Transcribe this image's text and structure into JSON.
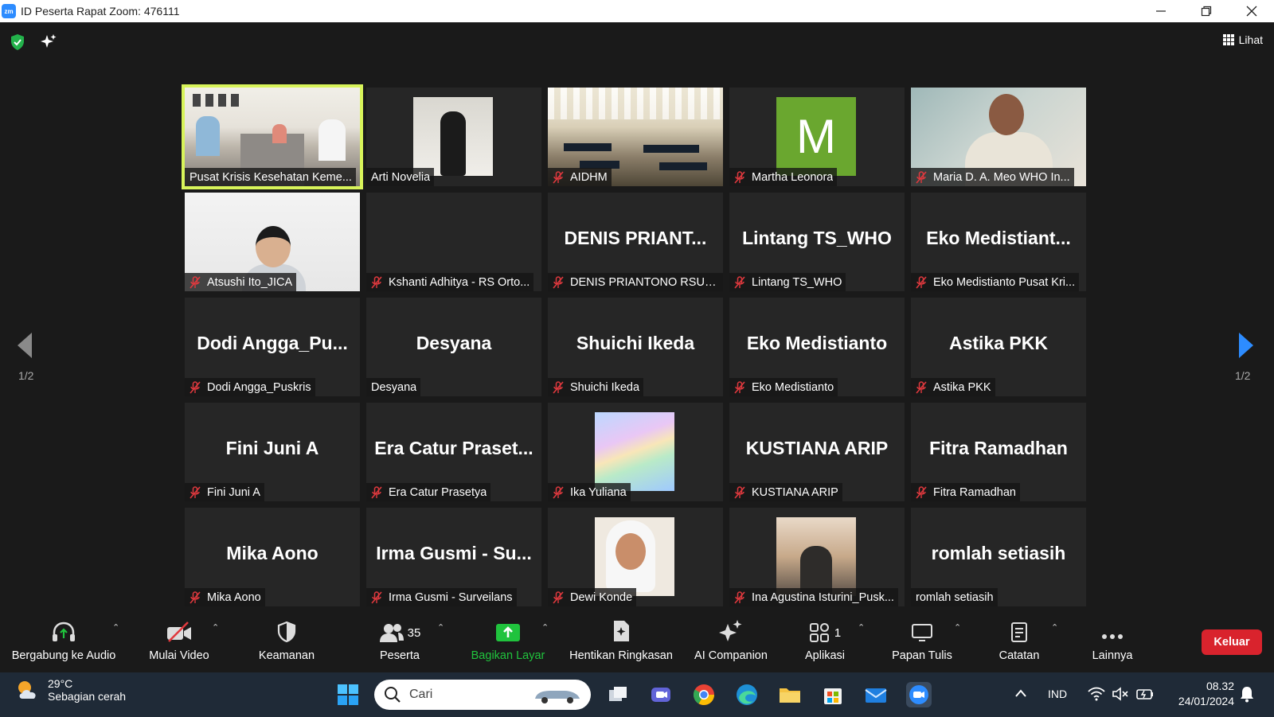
{
  "window": {
    "title": "ID Peserta Rapat Zoom: 476111",
    "app_logo": "zm",
    "controls": [
      "minimize-icon",
      "restore-icon",
      "close-icon"
    ]
  },
  "top": {
    "view_label": "Lihat"
  },
  "pagination": {
    "left": "1/2",
    "right": "1/2"
  },
  "participants": [
    {
      "label": "Pusat Krisis Kesehatan Keme...",
      "big_name": "",
      "muted": false,
      "photo": "room1",
      "active": true
    },
    {
      "label": "Arti Novelia",
      "big_name": "",
      "muted": false,
      "photo": "arti"
    },
    {
      "label": "AIDHM",
      "big_name": "",
      "muted": true,
      "photo": "hall"
    },
    {
      "label": "Martha Leonora",
      "big_name": "",
      "muted": true,
      "photo": "avatar",
      "avatar_letter": "M",
      "avatar_color": "#6aa72f"
    },
    {
      "label": "Maria D. A. Meo WHO In...",
      "big_name": "",
      "muted": true,
      "photo": "maria"
    },
    {
      "label": "Atsushi Ito_JICA",
      "big_name": "",
      "muted": true,
      "photo": "atsushi"
    },
    {
      "label": "Kshanti Adhitya - RS Orto...",
      "big_name": "",
      "muted": true,
      "photo": "none"
    },
    {
      "label": "DENIS PRIANTONO RSUP...",
      "big_name": "DENIS  PRIANT...",
      "muted": true,
      "photo": "none"
    },
    {
      "label": "Lintang TS_WHO",
      "big_name": "Lintang TS_WHO",
      "muted": true,
      "photo": "none"
    },
    {
      "label": "Eko Medistianto Pusat Kri...",
      "big_name": "Eko  Medistiant...",
      "muted": true,
      "photo": "none"
    },
    {
      "label": "Dodi Angga_Puskris",
      "big_name": "Dodi  Angga_Pu...",
      "muted": true,
      "photo": "none"
    },
    {
      "label": "Desyana",
      "big_name": "Desyana",
      "muted": false,
      "photo": "none"
    },
    {
      "label": "Shuichi Ikeda",
      "big_name": "Shuichi Ikeda",
      "muted": true,
      "photo": "none"
    },
    {
      "label": "Eko Medistianto",
      "big_name": "Eko Medistianto",
      "muted": true,
      "photo": "none"
    },
    {
      "label": "Astika PKK",
      "big_name": "Astika PKK",
      "muted": true,
      "photo": "none"
    },
    {
      "label": "Fini Juni A",
      "big_name": "Fini Juni A",
      "muted": true,
      "photo": "none"
    },
    {
      "label": "Era Catur Prasetya",
      "big_name": "Era  Catur  Praset...",
      "muted": true,
      "photo": "none"
    },
    {
      "label": "Ika Yuliana",
      "big_name": "",
      "muted": true,
      "photo": "rainbow"
    },
    {
      "label": "KUSTIANA ARIP",
      "big_name": "KUSTIANA ARIP",
      "muted": true,
      "photo": "none"
    },
    {
      "label": "Fitra Ramadhan",
      "big_name": "Fitra Ramadhan",
      "muted": true,
      "photo": "none"
    },
    {
      "label": "Mika Aono",
      "big_name": "Mika Aono",
      "muted": true,
      "photo": "none"
    },
    {
      "label": "Irma Gusmi - Surveilans",
      "big_name": "Irma  Gusmi  -  Su...",
      "muted": true,
      "photo": "none"
    },
    {
      "label": "Dewi Konde",
      "big_name": "",
      "muted": true,
      "photo": "dewi"
    },
    {
      "label": "Ina Agustina Isturini_Pusk...",
      "big_name": "",
      "muted": true,
      "photo": "ina"
    },
    {
      "label": "romlah setiasih",
      "big_name": "romlah setiasih",
      "muted": false,
      "photo": "none"
    }
  ],
  "toolbar": {
    "audio": "Bergabung ke Audio",
    "video": "Mulai Video",
    "security": "Keamanan",
    "participants": "Peserta",
    "participant_count": "35",
    "share": "Bagikan Layar",
    "summary": "Hentikan Ringkasan",
    "companion": "AI Companion",
    "apps": "Aplikasi",
    "apps_count": "1",
    "whiteboard": "Papan Tulis",
    "notes": "Catatan",
    "more": "Lainnya",
    "leave": "Keluar",
    "share_color": "#20c33d",
    "leave_color": "#d9232d"
  },
  "taskbar": {
    "temperature": "29°C",
    "weather": "Sebagian cerah",
    "search_placeholder": "Cari",
    "language": "IND",
    "time": "08.32",
    "date": "24/01/2024"
  }
}
